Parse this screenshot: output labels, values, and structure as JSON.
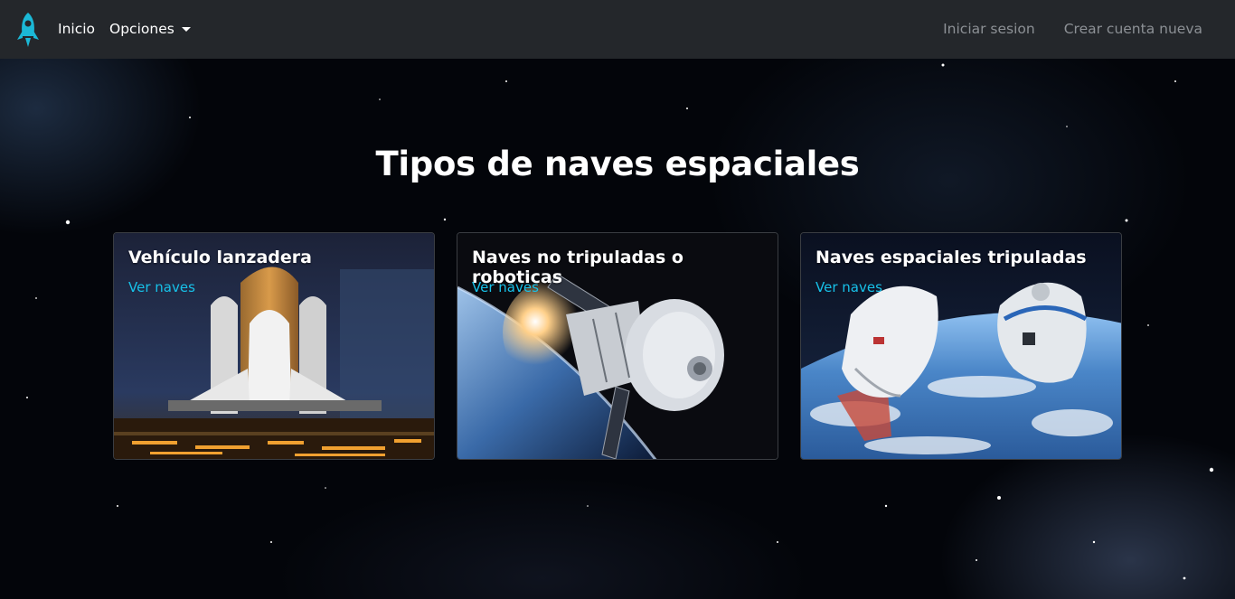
{
  "navbar": {
    "brand_icon": "rocket-icon",
    "home_label": "Inicio",
    "options_label": "Opciones",
    "login_label": "Iniciar sesion",
    "signup_label": "Crear cuenta nueva"
  },
  "main": {
    "title": "Tipos de naves espaciales"
  },
  "cards": [
    {
      "title": "Vehículo lanzadera",
      "link_label": "Ver naves"
    },
    {
      "title": "Naves no tripuladas o roboticas",
      "link_label": "Ver naves"
    },
    {
      "title": "Naves espaciales tripuladas",
      "link_label": "Ver naves"
    }
  ],
  "colors": {
    "navbar_bg": "#24272b",
    "link_accent": "#17c1e8",
    "brand_accent": "#1bb8d6"
  }
}
